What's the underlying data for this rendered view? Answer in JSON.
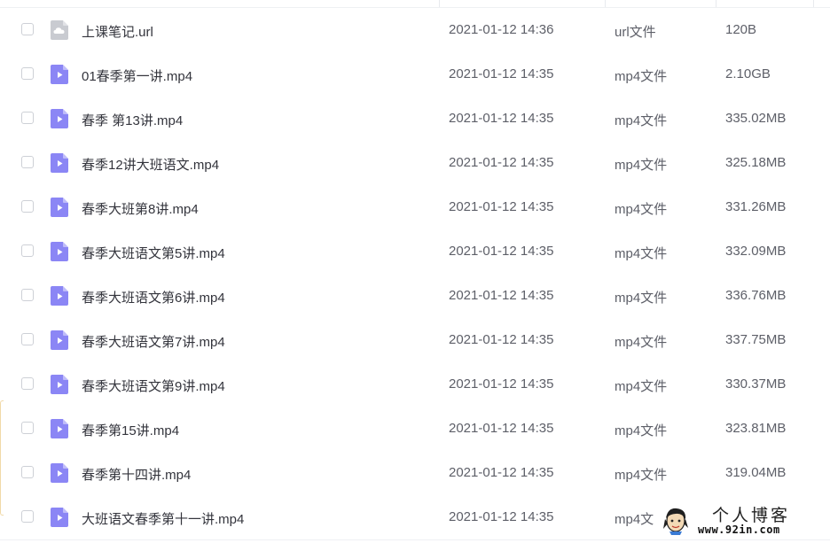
{
  "files": [
    {
      "name": "上课笔记.url",
      "date": "2021-01-12 14:36",
      "type": "url文件",
      "size": "120B",
      "icon": "link-file-icon"
    },
    {
      "name": "01春季第一讲.mp4",
      "date": "2021-01-12 14:35",
      "type": "mp4文件",
      "size": "2.10GB",
      "icon": "video-file-icon"
    },
    {
      "name": "春季 第13讲.mp4",
      "date": "2021-01-12 14:35",
      "type": "mp4文件",
      "size": "335.02MB",
      "icon": "video-file-icon"
    },
    {
      "name": "春季12讲大班语文.mp4",
      "date": "2021-01-12 14:35",
      "type": "mp4文件",
      "size": "325.18MB",
      "icon": "video-file-icon"
    },
    {
      "name": "春季大班第8讲.mp4",
      "date": "2021-01-12 14:35",
      "type": "mp4文件",
      "size": "331.26MB",
      "icon": "video-file-icon"
    },
    {
      "name": "春季大班语文第5讲.mp4",
      "date": "2021-01-12 14:35",
      "type": "mp4文件",
      "size": "332.09MB",
      "icon": "video-file-icon"
    },
    {
      "name": "春季大班语文第6讲.mp4",
      "date": "2021-01-12 14:35",
      "type": "mp4文件",
      "size": "336.76MB",
      "icon": "video-file-icon"
    },
    {
      "name": "春季大班语文第7讲.mp4",
      "date": "2021-01-12 14:35",
      "type": "mp4文件",
      "size": "337.75MB",
      "icon": "video-file-icon"
    },
    {
      "name": "春季大班语文第9讲.mp4",
      "date": "2021-01-12 14:35",
      "type": "mp4文件",
      "size": "330.37MB",
      "icon": "video-file-icon"
    },
    {
      "name": "春季第15讲.mp4",
      "date": "2021-01-12 14:35",
      "type": "mp4文件",
      "size": "323.81MB",
      "icon": "video-file-icon"
    },
    {
      "name": "春季第十四讲.mp4",
      "date": "2021-01-12 14:35",
      "type": "mp4文件",
      "size": "319.04MB",
      "icon": "video-file-icon"
    },
    {
      "name": "大班语文春季第十一讲.mp4",
      "date": "2021-01-12 14:35",
      "type": "mp4文",
      "size": "",
      "icon": "video-file-icon"
    }
  ],
  "watermark": {
    "title": "个人博客",
    "url": "www.92in.com"
  },
  "colors": {
    "video_icon": "#8b86f5",
    "link_icon": "#c9cbd1",
    "text_primary": "#33343c",
    "text_secondary": "#5d5f68"
  }
}
